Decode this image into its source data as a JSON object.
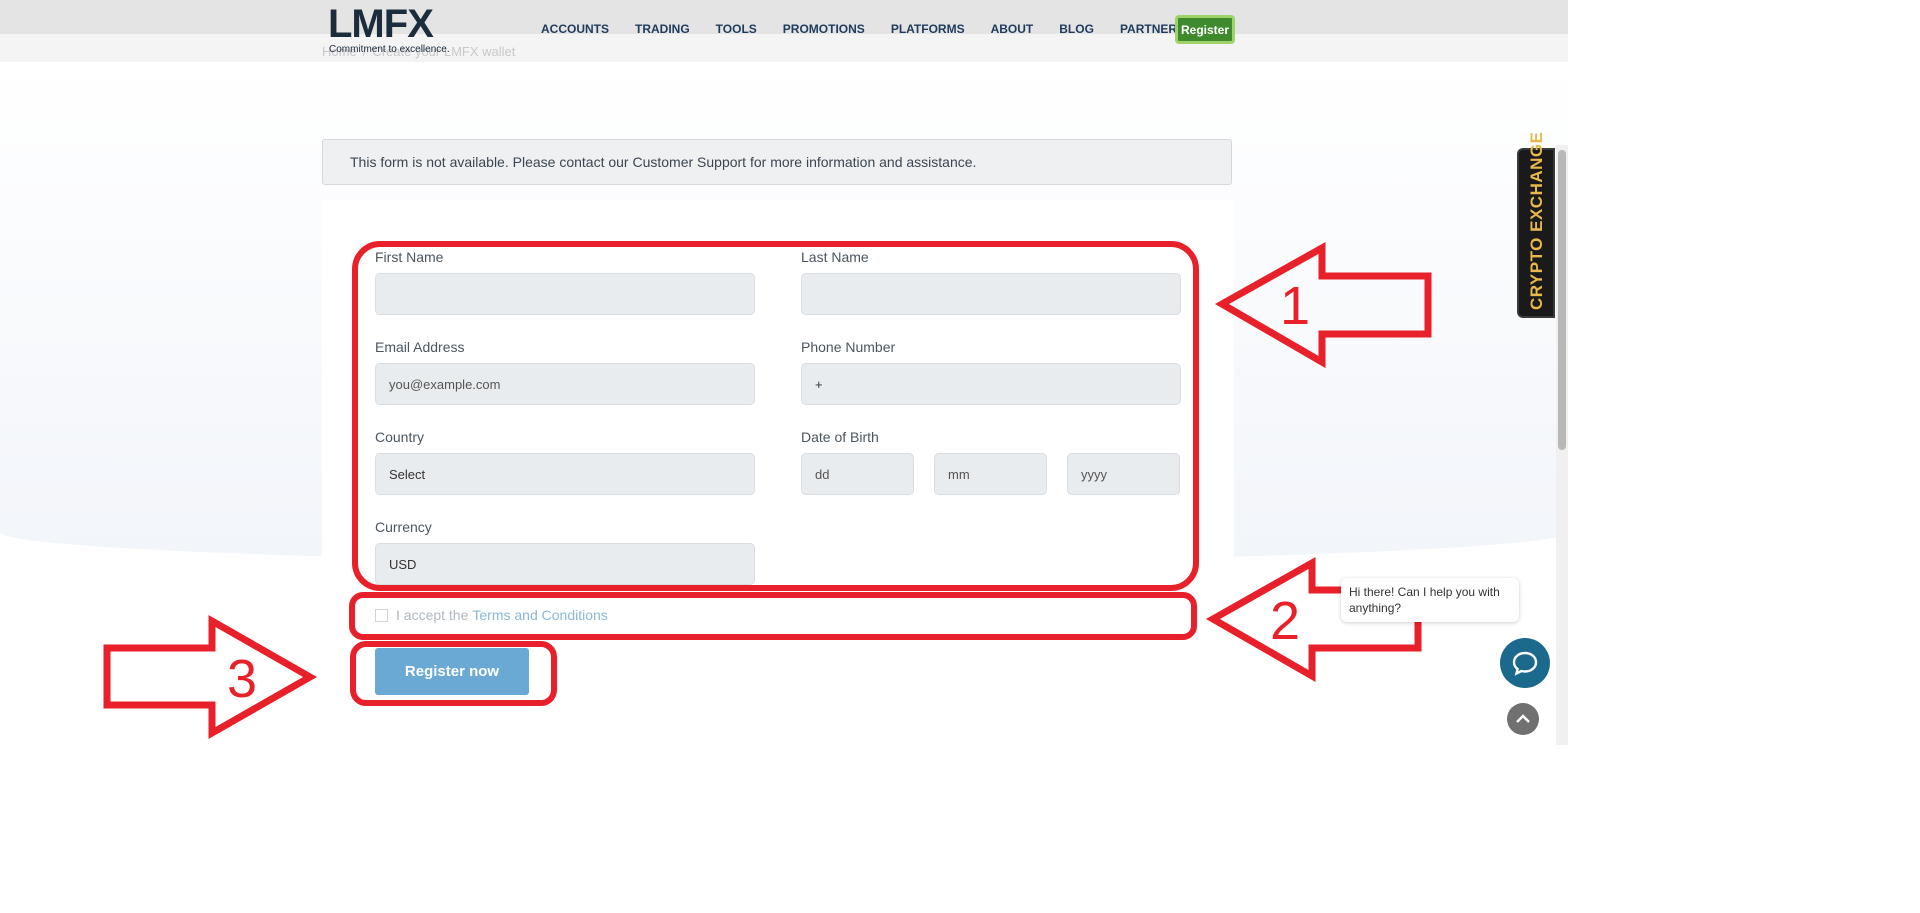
{
  "header": {
    "logo_text": "LMFX",
    "logo_tagline": "Commitment to excellence.",
    "breadcrumb": [
      "Home",
      "/",
      "Create your LMFX wallet"
    ],
    "nav": [
      "ACCOUNTS",
      "TRADING",
      "TOOLS",
      "PROMOTIONS",
      "PLATFORMS",
      "ABOUT",
      "BLOG",
      "PARTNERSHIP"
    ],
    "register_label": "Register"
  },
  "alert": {
    "message": "This form is not available. Please contact our Customer Support for more information and assistance."
  },
  "form": {
    "first_name_label": "First Name",
    "last_name_label": "Last Name",
    "email_label": "Email Address",
    "email_placeholder": "you@example.com",
    "phone_label": "Phone Number",
    "phone_value": "+",
    "country_label": "Country",
    "country_value": "Select",
    "dob_label": "Date of Birth",
    "dob_day": "dd",
    "dob_month": "mm",
    "dob_year": "yyyy",
    "currency_label": "Currency",
    "currency_value": "USD",
    "terms_prefix": "I accept the",
    "terms_link": "Terms and Conditions",
    "submit_label": "Register now"
  },
  "annotations": {
    "step1": "1",
    "step2": "2",
    "step3": "3",
    "color": "#e8202a"
  },
  "side_tab": {
    "label": "CRYPTO EXCHANGE"
  },
  "chat": {
    "message": "Hi there! Can I help you with anything?"
  }
}
